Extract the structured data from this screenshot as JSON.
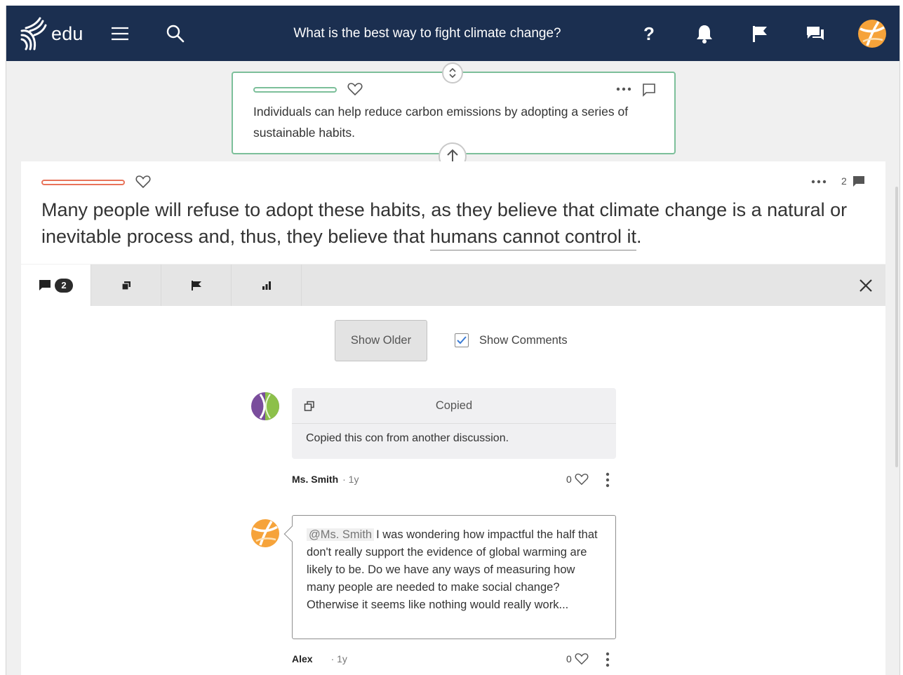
{
  "header": {
    "logo_text": "edu",
    "title": "What is the best way to fight climate change?",
    "help_label": "?"
  },
  "parent_claim": {
    "text": "Individuals can help reduce carbon emissions by adopting a series of sustainable habits.",
    "accent_color": "#7cbf9a"
  },
  "main_claim": {
    "text_before": "Many people will refuse to adopt these habits, as they believe that climate change is a natural or inevitable process and, thus, they believe that ",
    "text_highlight": "humans cannot control it",
    "text_after": ".",
    "comment_count": "2",
    "accent_color": "#e8735a"
  },
  "tabs": {
    "comments_badge": "2"
  },
  "controls": {
    "show_older_label": "Show Older",
    "show_comments_label": "Show Comments",
    "show_comments_checked": true
  },
  "comments": [
    {
      "title": "Copied",
      "body": "Copied this con from another discussion.",
      "author": "Ms. Smith",
      "time": "· 1y",
      "likes": "0"
    },
    {
      "mention": "@Ms. Smith",
      "body": "I was wondering how impactful the half that don't really support the evidence of global warming are likely to be. Do we have any ways of measuring how many people are needed to make social change? Otherwise it seems like nothing would really work...",
      "author": "Alex",
      "time": "· 1y",
      "likes": "0"
    }
  ]
}
